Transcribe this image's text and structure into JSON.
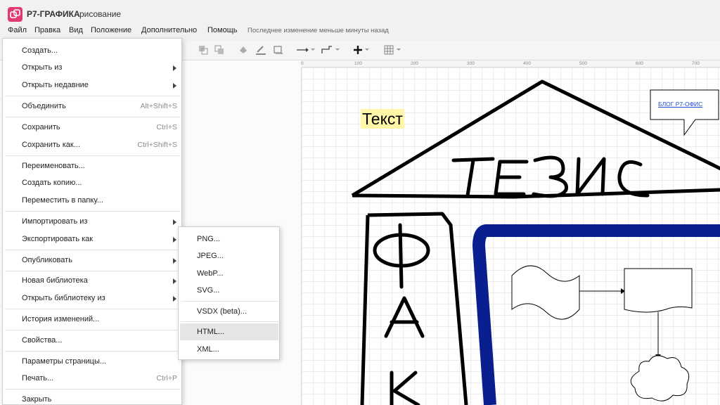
{
  "app": {
    "name": "Р7-ГРАФИКА",
    "document": "рисование"
  },
  "menubar": {
    "items": [
      "Файл",
      "Правка",
      "Вид",
      "Положение",
      "Дополнительно",
      "Помощь"
    ],
    "status": "Последнее изменение меньше минуты назад"
  },
  "ruler": {
    "labels": [
      "0",
      "100",
      "200",
      "300",
      "400",
      "500",
      "600",
      "700"
    ]
  },
  "canvas": {
    "text_box": "Текст",
    "callout_link": "БЛОГ Р7-ОФИС",
    "handwriting_roof": "ТЕЗИС",
    "handwriting_column": "ФАК",
    "colors": {
      "blue_stroke": "#0a1f8f",
      "text_highlight": "#fff6a8",
      "link": "#1a4fd6"
    }
  },
  "file_menu": {
    "items": [
      {
        "label": "Создать...",
        "shortcut": "",
        "submenu": false
      },
      {
        "label": "Открыть из",
        "shortcut": "",
        "submenu": true
      },
      {
        "label": "Открыть недавние",
        "shortcut": "",
        "submenu": true
      },
      {
        "label": "Объединить",
        "shortcut": "Alt+Shift+S",
        "submenu": false
      },
      {
        "label": "Сохранить",
        "shortcut": "Ctrl+S",
        "submenu": false
      },
      {
        "label": "Сохранить как...",
        "shortcut": "Ctrl+Shift+S",
        "submenu": false
      },
      {
        "label": "Переименовать...",
        "shortcut": "",
        "submenu": false
      },
      {
        "label": "Создать копию...",
        "shortcut": "",
        "submenu": false
      },
      {
        "label": "Переместить в папку...",
        "shortcut": "",
        "submenu": false
      },
      {
        "label": "Импортировать из",
        "shortcut": "",
        "submenu": true
      },
      {
        "label": "Экспортировать как",
        "shortcut": "",
        "submenu": true
      },
      {
        "label": "Опубликовать",
        "shortcut": "",
        "submenu": true
      },
      {
        "label": "Новая библиотека",
        "shortcut": "",
        "submenu": true
      },
      {
        "label": "Открыть библиотеку из",
        "shortcut": "",
        "submenu": true
      },
      {
        "label": "История изменений...",
        "shortcut": "",
        "submenu": false
      },
      {
        "label": "Свойства...",
        "shortcut": "",
        "submenu": false
      },
      {
        "label": "Параметры страницы...",
        "shortcut": "",
        "submenu": false
      },
      {
        "label": "Печать...",
        "shortcut": "Ctrl+P",
        "submenu": false
      },
      {
        "label": "Закрыть",
        "shortcut": "",
        "submenu": false
      }
    ]
  },
  "export_submenu": {
    "items": [
      "PNG...",
      "JPEG...",
      "WebP...",
      "SVG...",
      "VSDX (beta)...",
      "HTML...",
      "XML..."
    ],
    "highlighted": "HTML..."
  }
}
